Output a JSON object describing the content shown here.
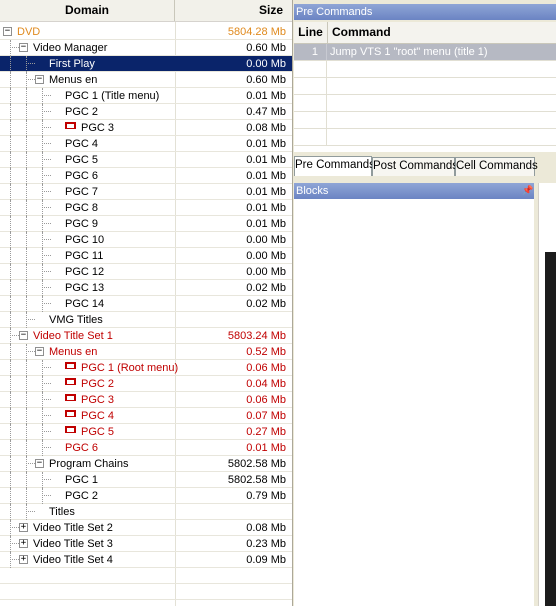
{
  "tree": {
    "header": {
      "domain": "Domain",
      "size": "Size"
    },
    "rows": [
      {
        "label": "DVD",
        "size": "5804.28 Mb",
        "depth": 0,
        "exp": "minus",
        "color": "orange"
      },
      {
        "label": "Video Manager",
        "size": "0.60 Mb",
        "depth": 1,
        "exp": "minus"
      },
      {
        "label": "First Play",
        "size": "0.00 Mb",
        "depth": 2,
        "selected": true
      },
      {
        "label": "Menus en",
        "size": "0.60 Mb",
        "depth": 2,
        "exp": "minus"
      },
      {
        "label": "PGC 1 (Title menu)",
        "size": "0.01 Mb",
        "depth": 3
      },
      {
        "label": "PGC 2",
        "size": "0.47 Mb",
        "depth": 3
      },
      {
        "label": "PGC 3",
        "size": "0.08 Mb",
        "depth": 3,
        "icon": true
      },
      {
        "label": "PGC 4",
        "size": "0.01 Mb",
        "depth": 3
      },
      {
        "label": "PGC 5",
        "size": "0.01 Mb",
        "depth": 3
      },
      {
        "label": "PGC 6",
        "size": "0.01 Mb",
        "depth": 3
      },
      {
        "label": "PGC 7",
        "size": "0.01 Mb",
        "depth": 3
      },
      {
        "label": "PGC 8",
        "size": "0.01 Mb",
        "depth": 3
      },
      {
        "label": "PGC 9",
        "size": "0.01 Mb",
        "depth": 3
      },
      {
        "label": "PGC 10",
        "size": "0.00 Mb",
        "depth": 3
      },
      {
        "label": "PGC 11",
        "size": "0.00 Mb",
        "depth": 3
      },
      {
        "label": "PGC 12",
        "size": "0.00 Mb",
        "depth": 3
      },
      {
        "label": "PGC 13",
        "size": "0.02 Mb",
        "depth": 3
      },
      {
        "label": "PGC 14",
        "size": "0.02 Mb",
        "depth": 3
      },
      {
        "label": "VMG Titles",
        "size": "",
        "depth": 2
      },
      {
        "label": "Video Title Set 1",
        "size": "5803.24 Mb",
        "depth": 1,
        "exp": "minus",
        "color": "red"
      },
      {
        "label": "Menus en",
        "size": "0.52 Mb",
        "depth": 2,
        "exp": "minus",
        "color": "red"
      },
      {
        "label": "PGC 1 (Root menu)",
        "size": "0.06 Mb",
        "depth": 3,
        "icon": true,
        "color": "red"
      },
      {
        "label": "PGC 2",
        "size": "0.04 Mb",
        "depth": 3,
        "icon": true,
        "color": "red"
      },
      {
        "label": "PGC 3",
        "size": "0.06 Mb",
        "depth": 3,
        "icon": true,
        "color": "red"
      },
      {
        "label": "PGC 4",
        "size": "0.07 Mb",
        "depth": 3,
        "icon": true,
        "color": "red"
      },
      {
        "label": "PGC 5",
        "size": "0.27 Mb",
        "depth": 3,
        "icon": true,
        "color": "red"
      },
      {
        "label": "PGC 6",
        "size": "0.01 Mb",
        "depth": 3,
        "color": "red"
      },
      {
        "label": "Program Chains",
        "size": "5802.58 Mb",
        "depth": 2,
        "exp": "minus"
      },
      {
        "label": "PGC 1",
        "size": "5802.58 Mb",
        "depth": 3
      },
      {
        "label": "PGC 2",
        "size": "0.79 Mb",
        "depth": 3
      },
      {
        "label": "Titles",
        "size": "",
        "depth": 2
      },
      {
        "label": "Video Title Set 2",
        "size": "0.08 Mb",
        "depth": 1,
        "exp": "plus"
      },
      {
        "label": "Video Title Set 3",
        "size": "0.23 Mb",
        "depth": 1,
        "exp": "plus"
      },
      {
        "label": "Video Title Set 4",
        "size": "0.09 Mb",
        "depth": 1,
        "exp": "plus"
      }
    ]
  },
  "commands": {
    "title": "Pre Commands",
    "col_line": "Line",
    "col_command": "Command",
    "rows": [
      {
        "line": "1",
        "command": "Jump VTS 1 \"root\" menu (title 1)"
      }
    ]
  },
  "tabs": [
    "Pre Commands",
    "Post Commands",
    "Cell Commands"
  ],
  "blocks": {
    "title": "Blocks"
  },
  "colors": {
    "red": "#c00000",
    "orange": "#e08a1e",
    "selection": "#0a246a",
    "title_bar": "#7b92cb"
  }
}
